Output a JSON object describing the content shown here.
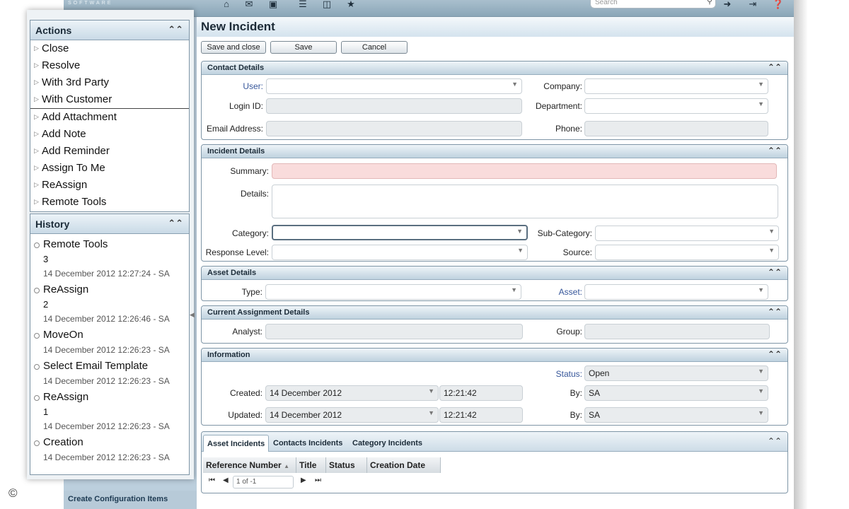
{
  "topbar": {
    "brand": "SOFTWARE",
    "icons": [
      "home-icon",
      "mail-icon",
      "calendar-icon",
      "list-icon",
      "computer-icon",
      "star-icon",
      "forward-icon",
      "logout-icon",
      "help-icon"
    ],
    "search_placeholder": "Search"
  },
  "sidebar": {
    "actions_title": "Actions",
    "actions_group1": [
      "Close",
      "Resolve",
      "With 3rd Party",
      "With Customer"
    ],
    "actions_group2": [
      "Add Attachment",
      "Add Note",
      "Add Reminder",
      "Assign To Me",
      "ReAssign",
      "Remote Tools"
    ],
    "history_title": "History",
    "history": [
      {
        "title": "Remote Tools",
        "number": "3",
        "date": "14 December 2012 12:27:24 - SA"
      },
      {
        "title": "ReAssign",
        "number": "2",
        "date": "14 December 2012 12:26:46 - SA"
      },
      {
        "title": "MoveOn",
        "number": "",
        "date": "14 December 2012 12:26:23 - SA"
      },
      {
        "title": "Select Email Template",
        "number": "",
        "date": "14 December 2012 12:26:23 - SA"
      },
      {
        "title": "ReAssign",
        "number": "1",
        "date": "14 December 2012 12:26:23 - SA"
      },
      {
        "title": "Creation",
        "number": "",
        "date": "14 December 2012 12:26:23 - SA"
      }
    ],
    "bottom_link": "Create Configuration Items"
  },
  "main": {
    "title": "New Incident",
    "buttons": {
      "save_close": "Save and close",
      "save": "Save",
      "cancel": "Cancel"
    },
    "contact": {
      "title": "Contact Details",
      "user_label": "User:",
      "user_value": "",
      "login_label": "Login ID:",
      "login_value": "",
      "email_label": "Email Address:",
      "email_value": "",
      "company_label": "Company:",
      "company_value": "",
      "department_label": "Department:",
      "department_value": "",
      "phone_label": "Phone:",
      "phone_value": ""
    },
    "incident": {
      "title": "Incident Details",
      "summary_label": "Summary:",
      "details_label": "Details:",
      "category_label": "Category:",
      "subcategory_label": "Sub-Category:",
      "response_label": "Response Level:",
      "source_label": "Source:"
    },
    "asset": {
      "title": "Asset Details",
      "type_label": "Type:",
      "asset_label": "Asset:"
    },
    "assignment": {
      "title": "Current Assignment Details",
      "analyst_label": "Analyst:",
      "group_label": "Group:"
    },
    "information": {
      "title": "Information",
      "status_label": "Status:",
      "status_value": "Open",
      "created_label": "Created:",
      "created_date": "14 December 2012",
      "created_time": "12:21:42",
      "created_by_label": "By:",
      "created_by": "SA",
      "updated_label": "Updated:",
      "updated_date": "14 December 2012",
      "updated_time": "12:21:42",
      "updated_by_label": "By:",
      "updated_by": "SA"
    },
    "tabs": [
      "Asset Incidents",
      "Contacts Incidents",
      "Category Incidents"
    ],
    "grid_columns": [
      "Reference Number",
      "Title",
      "Status",
      "Creation Date"
    ],
    "pager": {
      "page_text": "1 of -1"
    }
  }
}
